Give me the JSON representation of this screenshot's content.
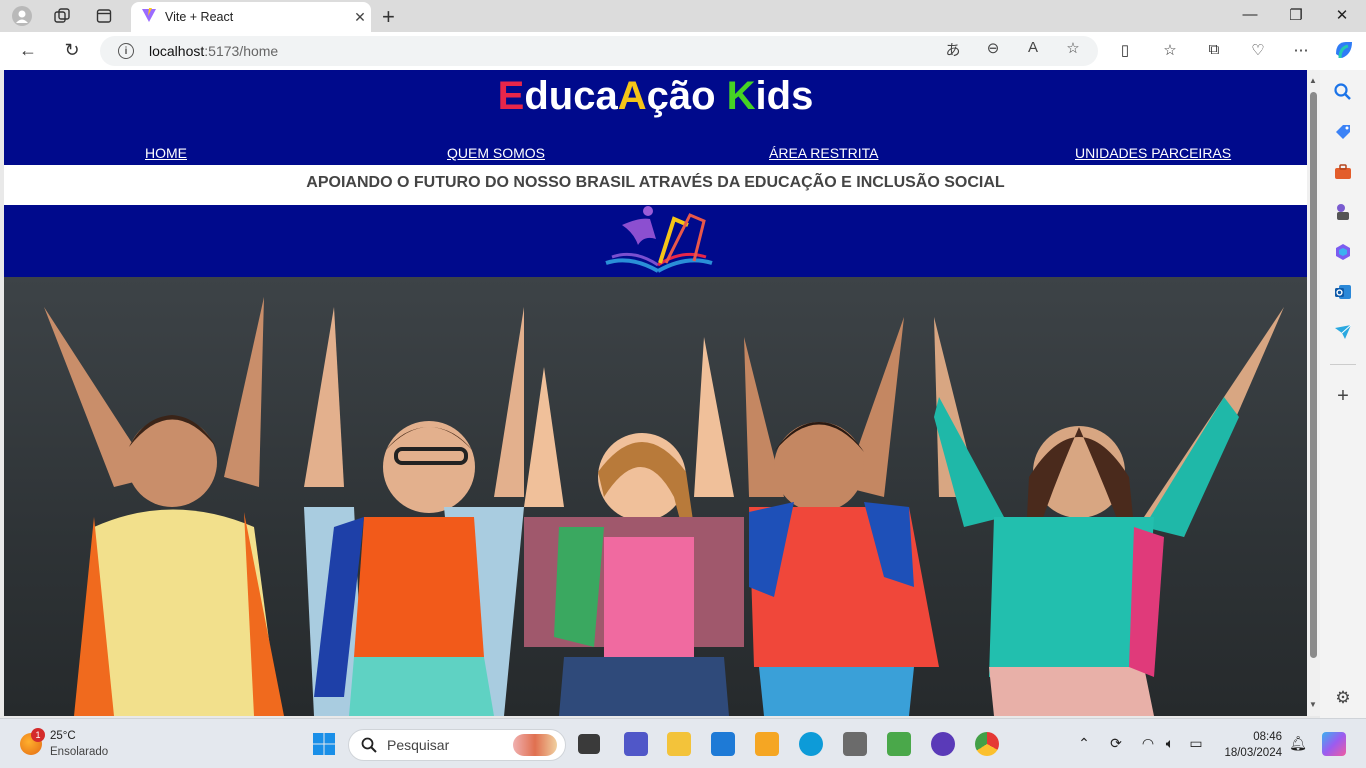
{
  "browser": {
    "tab_title": "Vite + React",
    "url_host": "localhost",
    "url_path": ":5173/home"
  },
  "site": {
    "brand_parts": [
      "E",
      "duca",
      "A",
      "ção ",
      "K",
      "ids"
    ],
    "nav": [
      "HOME",
      "QUEM SOMOS",
      "ÁREA RESTRITA",
      "UNIDADES PARCEIRAS"
    ],
    "tagline": "APOIANDO O FUTURO DO NOSSO BRASIL ATRAVÉS DA EDUCAÇÃO E INCLUSÃO SOCIAL",
    "colors": {
      "header_bg": "#000a8c",
      "e": "#e8264a",
      "a": "#f5c518",
      "k": "#46d224"
    }
  },
  "taskbar": {
    "weather_badge": "1",
    "temperature": "25°C",
    "condition": "Ensolarado",
    "search_placeholder": "Pesquisar",
    "time": "08:46",
    "date": "18/03/2024"
  }
}
